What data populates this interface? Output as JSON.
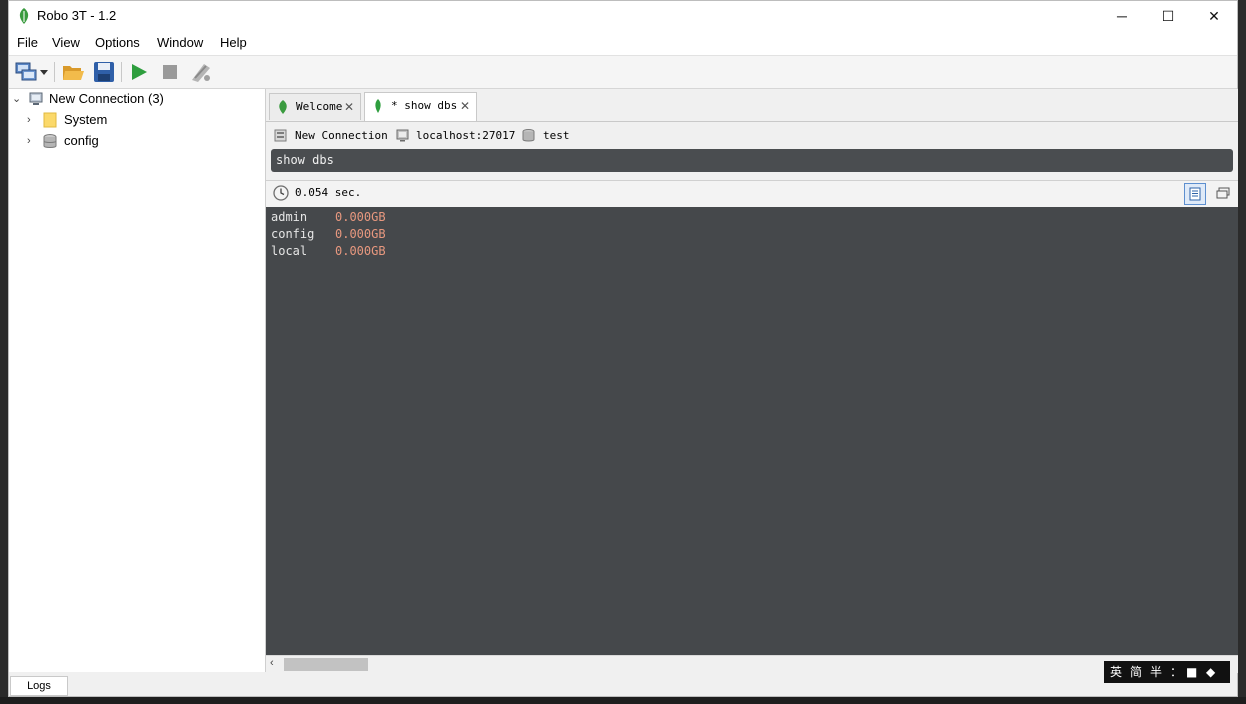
{
  "window": {
    "title": "Robo 3T - 1.2"
  },
  "window_controls": {
    "minimize": "─",
    "maximize": "☐",
    "close": "✕"
  },
  "menu": {
    "items": [
      "File",
      "View",
      "Options",
      "Window",
      "Help"
    ]
  },
  "toolbar": {
    "icons": [
      "connect-icon",
      "dropdown-arrow-icon",
      "open-icon",
      "save-icon",
      "execute-icon",
      "stop-icon",
      "format-icon"
    ]
  },
  "tree": {
    "root": {
      "label": "New Connection (3)",
      "icon": "computer-icon"
    },
    "children": [
      {
        "label": "System",
        "icon": "folder-icon"
      },
      {
        "label": "config",
        "icon": "database-icon"
      }
    ]
  },
  "tabs": [
    {
      "label": "Welcome",
      "icon": "robo-leaf-icon",
      "active": false
    },
    {
      "label": "* show dbs",
      "icon": "mongo-leaf-icon",
      "active": true
    }
  ],
  "context": {
    "connection": "New Connection",
    "server": "localhost:27017",
    "database": "test"
  },
  "editor": {
    "query": "show dbs"
  },
  "result": {
    "elapsed": "0.054 sec.",
    "rows": [
      {
        "name": "admin",
        "size": "0.000GB"
      },
      {
        "name": "config",
        "size": "0.000GB"
      },
      {
        "name": "local",
        "size": "0.000GB"
      }
    ]
  },
  "bottom": {
    "logs_label": "Logs"
  },
  "ime": {
    "chars": [
      "英",
      "简",
      "半",
      "：",
      "■",
      "◆"
    ]
  },
  "colors": {
    "output_bg": "#45484b",
    "size_text": "#e8987f",
    "editor_bg": "#4a4d50",
    "accent_green": "#2e9e3e"
  }
}
